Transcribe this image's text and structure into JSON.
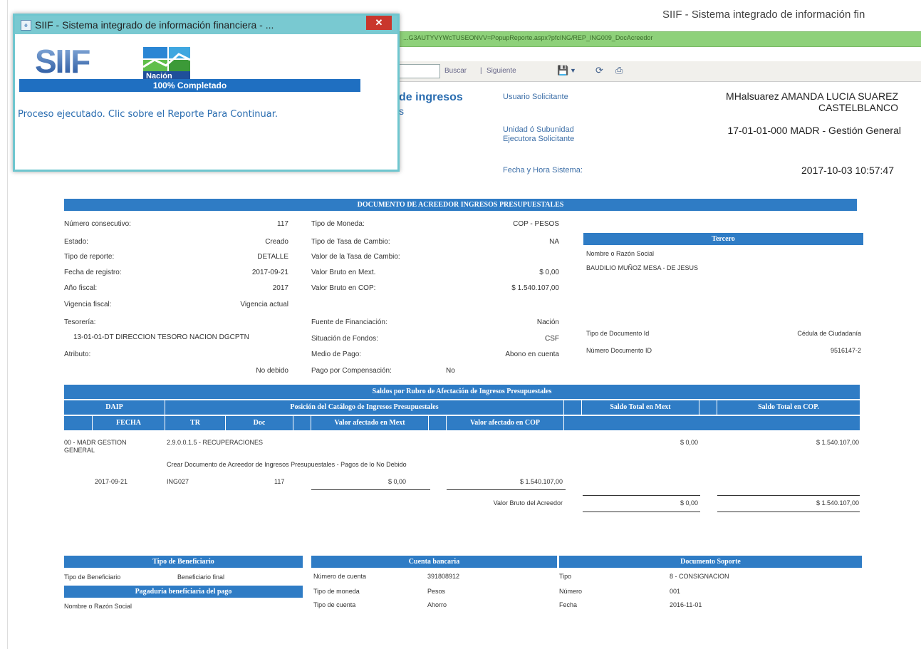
{
  "window": {
    "title": "SIIF - Sistema integrado de información fin"
  },
  "address_bar": {
    "url": "...G3AUTYVYWcTUSEONVV=PopupReporte.aspx?pfcING/REP_ING009_DocAcreedor"
  },
  "toolbar": {
    "find_label": "Buscar",
    "separator": "|",
    "next_label": "Siguiente"
  },
  "report_header": {
    "title_fragment": "de ingresos",
    "subtitle_fragment": "s",
    "user_label": "Usuario Solicitante",
    "user_value_line1": "MHalsuarez AMANDA LUCIA SUAREZ",
    "user_value_line2": "CASTELBLANCO",
    "unit_label_line1": "Unidad ó Subunidad",
    "unit_label_line2": "Ejecutora Solicitante",
    "unit_value": "17-01-01-000 MADR - Gestión General",
    "datetime_label": "Fecha y Hora Sistema:",
    "datetime_value": "2017-10-03 10:57:47"
  },
  "document": {
    "title": "DOCUMENTO DE ACREEDOR INGRESOS PRESUPUESTALES",
    "left": [
      {
        "label": "Número consecutivo:",
        "value": "117"
      },
      {
        "label": "Estado:",
        "value": "Creado"
      },
      {
        "label": "Tipo de reporte:",
        "value": "DETALLE"
      },
      {
        "label": "Fecha de registro:",
        "value": "2017-09-21"
      },
      {
        "label": "Año fiscal:",
        "value": "2017"
      },
      {
        "label": "Vigencia fiscal:",
        "value": "Vigencia actual"
      }
    ],
    "tesoreria_label": "Tesorería:",
    "tesoreria_value": "13-01-01-DT DIRECCION TESORO NACION DGCPTN",
    "atributo_label": "Atributo:",
    "atributo_value": "No debido",
    "middle": [
      {
        "label": "Tipo de Moneda:",
        "value": "COP - PESOS"
      },
      {
        "label": "Tipo de Tasa de Cambio:",
        "value": "NA"
      },
      {
        "label": "Valor de la Tasa de Cambio:",
        "value": ""
      },
      {
        "label": "Valor Bruto en Mext.",
        "value": "$ 0,00"
      },
      {
        "label": "Valor Bruto en COP:",
        "value": "$ 1.540.107,00"
      }
    ],
    "middle2": [
      {
        "label": "Fuente de Financiación:",
        "value": "Nación"
      },
      {
        "label": "Situación de Fondos:",
        "value": "CSF"
      },
      {
        "label": "Medio de Pago:",
        "value": "Abono en cuenta"
      },
      {
        "label": "Pago por Compensación:",
        "value": "No"
      }
    ],
    "tercero": {
      "title": "Tercero",
      "name_label": "Nombre o Razón Social",
      "name_value": "BAUDILIO MUÑOZ MESA - DE JESUS",
      "doc_type_label": "Tipo de Documento Id",
      "doc_type_value": "Cédula de Ciudadanía",
      "doc_num_label": "Número Documento ID",
      "doc_num_value": "9516147-2"
    }
  },
  "balances": {
    "title": "Saldos por Rubro de Afectación de Ingresos Presupuestales",
    "headers": {
      "daip": "DAIP",
      "posicion": "Posición del Catálogo de Ingresos Presupuestales",
      "saldo_mext": "Saldo Total en Mext",
      "saldo_cop": "Saldo Total en COP.",
      "fecha": "FECHA",
      "tr": "TR",
      "doc": "Doc",
      "valor_mext": "Valor afectado en Mext",
      "valor_cop": "Valor afectado en COP"
    },
    "row": {
      "daip_line1": "00 - MADR GESTION",
      "daip_line2": "GENERAL",
      "posicion": "2.9.0.0.1.5 - RECUPERACIONES",
      "saldo_mext": "$ 0,00",
      "saldo_cop": "$ 1.540.107,00",
      "description": "Crear Documento de Acreedor de Ingresos Presupuestales - Pagos de lo No Debido",
      "fecha": "2017-09-21",
      "tr": "ING027",
      "doc": "117",
      "valor_mext": "$ 0,00",
      "valor_cop": "$ 1.540.107,00"
    },
    "total_label": "Valor Bruto del Acreedor",
    "total_mext": "$ 0,00",
    "total_cop": "$ 1.540.107,00"
  },
  "beneficiario": {
    "title": "Tipo de Beneficiario",
    "type_label": "Tipo de Beneficiario",
    "type_value": "Beneficiario final",
    "pagaduria_title": "Pagaduria beneficiaria del pago",
    "name_label": "Nombre o Razón Social"
  },
  "cuenta": {
    "title": "Cuenta bancaria",
    "rows": [
      {
        "label": "Número de cuenta",
        "value": "391808912"
      },
      {
        "label": "Tipo de moneda",
        "value": "Pesos"
      },
      {
        "label": "Tipo de cuenta",
        "value": "Ahorro"
      }
    ]
  },
  "soporte": {
    "title": "Documento Soporte",
    "rows": [
      {
        "label": "Tipo",
        "value": "8 - CONSIGNACION"
      },
      {
        "label": "Número",
        "value": "001"
      },
      {
        "label": "Fecha",
        "value": "2016-11-01"
      }
    ]
  },
  "popup": {
    "title": "SIIF - Sistema integrado de información financiera - ...",
    "close_glyph": "✕",
    "logo_text": "SIIF",
    "logo_sub": "Nación",
    "progress_text": "100% Completado",
    "progress_value": 1.0,
    "message": "Proceso ejecutado. Clic sobre el Reporte Para Continuar."
  },
  "colors": {
    "accent_blue": "#2f7cc5",
    "popup_border": "#6fc6cf",
    "address_green": "#8ed17a",
    "close_red": "#c9362c"
  }
}
